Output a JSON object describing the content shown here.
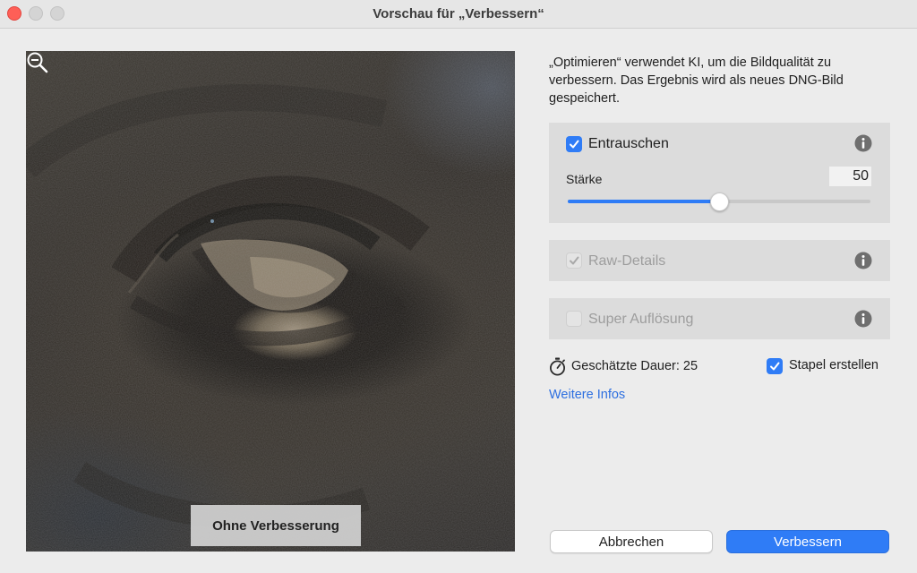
{
  "window": {
    "title": "Vorschau für „Verbessern“"
  },
  "preview": {
    "overlay_button_label": "Ohne Verbesserung",
    "zoom_icon": "zoom-out-icon"
  },
  "panel": {
    "description": "„Optimieren“ verwendet KI, um die Bildqualität zu verbessern. Das Ergebnis wird als neues DNG-Bild gespeichert.",
    "denoise": {
      "label": "Entrauschen",
      "checked": true,
      "strength_label": "Stärke",
      "strength_value": "50",
      "slider_fraction": 0.5
    },
    "raw_details": {
      "label": "Raw-Details",
      "checked": true,
      "disabled": true
    },
    "super_resolution": {
      "label": "Super Auflösung",
      "checked": false,
      "disabled": true
    },
    "duration_label": "Geschätzte Dauer: 25",
    "create_stack": {
      "label": "Stapel erstellen",
      "checked": true
    },
    "more_info_link": "Weitere Infos"
  },
  "buttons": {
    "cancel": "Abbrechen",
    "enhance": "Verbessern"
  },
  "colors": {
    "accent": "#2f7cf6",
    "close": "#fe5f57",
    "link": "#2d6fe0"
  }
}
